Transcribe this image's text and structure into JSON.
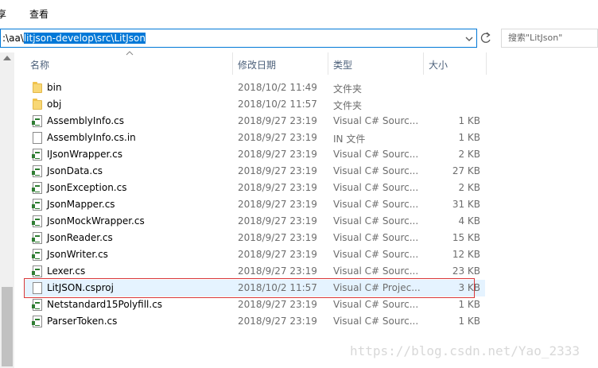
{
  "ribbon": {
    "share_tab": "享",
    "view_tab": "查看"
  },
  "address": {
    "prefix": ":\\aa\\",
    "selected_path": "litjson-develop\\src\\LitJson"
  },
  "search": {
    "placeholder": "搜索\"LitJson\""
  },
  "columns": {
    "name": "名称",
    "date": "修改日期",
    "type": "类型",
    "size": "大小"
  },
  "files": [
    {
      "name": "bin",
      "date": "2018/10/2 11:49",
      "type": "文件夹",
      "size": "",
      "icon": "folder-icon"
    },
    {
      "name": "obj",
      "date": "2018/10/2 11:57",
      "type": "文件夹",
      "size": "",
      "icon": "folder-icon"
    },
    {
      "name": "AssemblyInfo.cs",
      "date": "2018/9/27 23:19",
      "type": "Visual C# Sourc...",
      "size": "1 KB",
      "icon": "cs-file-icon"
    },
    {
      "name": "AssemblyInfo.cs.in",
      "date": "2018/9/27 23:19",
      "type": "IN 文件",
      "size": "1 KB",
      "icon": "file-icon"
    },
    {
      "name": "IJsonWrapper.cs",
      "date": "2018/9/27 23:19",
      "type": "Visual C# Sourc...",
      "size": "2 KB",
      "icon": "cs-file-icon"
    },
    {
      "name": "JsonData.cs",
      "date": "2018/9/27 23:19",
      "type": "Visual C# Sourc...",
      "size": "27 KB",
      "icon": "cs-file-icon"
    },
    {
      "name": "JsonException.cs",
      "date": "2018/9/27 23:19",
      "type": "Visual C# Sourc...",
      "size": "2 KB",
      "icon": "cs-file-icon"
    },
    {
      "name": "JsonMapper.cs",
      "date": "2018/9/27 23:19",
      "type": "Visual C# Sourc...",
      "size": "31 KB",
      "icon": "cs-file-icon"
    },
    {
      "name": "JsonMockWrapper.cs",
      "date": "2018/9/27 23:19",
      "type": "Visual C# Sourc...",
      "size": "4 KB",
      "icon": "cs-file-icon"
    },
    {
      "name": "JsonReader.cs",
      "date": "2018/9/27 23:19",
      "type": "Visual C# Sourc...",
      "size": "15 KB",
      "icon": "cs-file-icon"
    },
    {
      "name": "JsonWriter.cs",
      "date": "2018/9/27 23:19",
      "type": "Visual C# Sourc...",
      "size": "12 KB",
      "icon": "cs-file-icon"
    },
    {
      "name": "Lexer.cs",
      "date": "2018/9/27 23:19",
      "type": "Visual C# Sourc...",
      "size": "23 KB",
      "icon": "cs-file-icon"
    },
    {
      "name": "LitJSON.csproj",
      "date": "2018/10/2 11:57",
      "type": "Visual C# Projec...",
      "size": "3 KB",
      "icon": "file-icon"
    },
    {
      "name": "Netstandard15Polyfill.cs",
      "date": "2018/9/27 23:19",
      "type": "Visual C# Sourc...",
      "size": "1 KB",
      "icon": "cs-file-icon"
    },
    {
      "name": "ParserToken.cs",
      "date": "2018/9/27 23:19",
      "type": "Visual C# Sourc...",
      "size": "1 KB",
      "icon": "cs-file-icon"
    }
  ],
  "watermark": "https://blog.csdn.net/Yao_2333",
  "colors": {
    "accent": "#0078d7",
    "highlight_border": "#d9383a",
    "selected_row": "#e5f3ff"
  }
}
